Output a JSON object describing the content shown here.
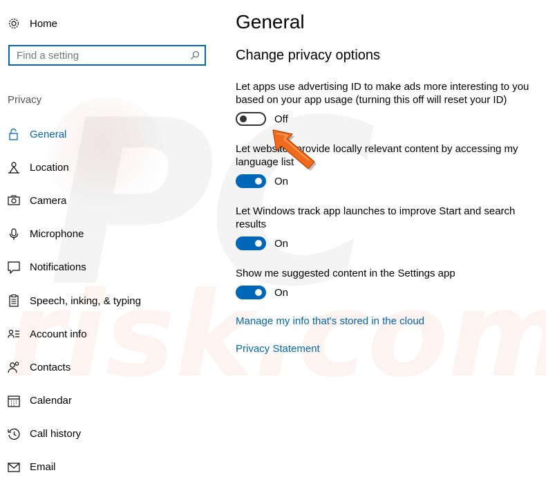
{
  "sidebar": {
    "home_label": "Home",
    "search_placeholder": "Find a setting",
    "section_label": "Privacy",
    "items": [
      {
        "label": "General",
        "icon": "lock-icon"
      },
      {
        "label": "Location",
        "icon": "location-icon"
      },
      {
        "label": "Camera",
        "icon": "camera-icon"
      },
      {
        "label": "Microphone",
        "icon": "microphone-icon"
      },
      {
        "label": "Notifications",
        "icon": "notifications-icon"
      },
      {
        "label": "Speech, inking, & typing",
        "icon": "speech-icon"
      },
      {
        "label": "Account info",
        "icon": "account-info-icon"
      },
      {
        "label": "Contacts",
        "icon": "contacts-icon"
      },
      {
        "label": "Calendar",
        "icon": "calendar-icon"
      },
      {
        "label": "Call history",
        "icon": "call-history-icon"
      },
      {
        "label": "Email",
        "icon": "email-icon"
      }
    ],
    "active_item": "General"
  },
  "main": {
    "title": "General",
    "section_title": "Change privacy options",
    "settings": [
      {
        "description": "Let apps use advertising ID to make ads more interesting to you based on your app usage (turning this off will reset your ID)",
        "state": "Off"
      },
      {
        "description": "Let websites provide locally relevant content by accessing my language list",
        "state": "On"
      },
      {
        "description": "Let Windows track app launches to improve Start and search results",
        "state": "On"
      },
      {
        "description": "Show me suggested content in the Settings app",
        "state": "On"
      }
    ],
    "links": {
      "manage_info": "Manage my info that's stored in the cloud",
      "privacy_statement": "Privacy Statement"
    }
  },
  "colors": {
    "accent": "#0067b8",
    "arrow": "#f26b1d"
  }
}
